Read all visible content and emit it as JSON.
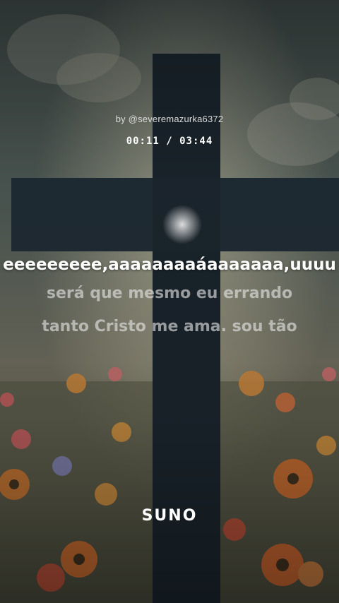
{
  "player": {
    "artist_line": "by @severemazurka6372",
    "time_display": "00:11 / 03:44"
  },
  "lyrics": {
    "current": "eeeeeeeee,aaaaaaaaáaaaaaaa,uuuu",
    "next_1": "será que mesmo eu errando",
    "next_2": "tanto Cristo me ama. sou tão"
  },
  "brand": {
    "logo_text": "SUNO"
  },
  "colors": {
    "lyric_active": "#ffffff",
    "lyric_inactive": "#c8c8c8"
  }
}
